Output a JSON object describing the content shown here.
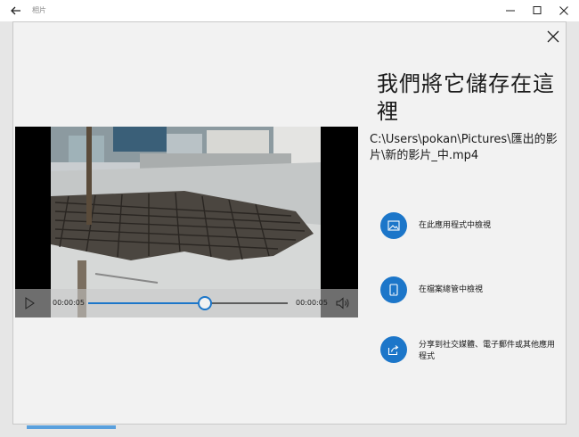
{
  "window": {
    "title": "相片"
  },
  "dialog": {
    "headline": "我們將它儲存在這裡",
    "path": "C:\\Users\\pokan\\Pictures\\匯出的影片\\新的影片_中.mp4"
  },
  "video": {
    "time_elapsed": "00:00:05",
    "time_total": "00:00:05",
    "progress": 0.58
  },
  "actions": [
    {
      "label": "在此應用程式中檢視",
      "icon": "image-icon"
    },
    {
      "label": "在檔案總管中檢視",
      "icon": "tablet-icon"
    },
    {
      "label": "分享到社交媒體、電子郵件或其他應用程式",
      "icon": "share-icon"
    }
  ],
  "colors": {
    "accent": "#1c76c9",
    "dialog_bg": "#f2f2f2"
  }
}
